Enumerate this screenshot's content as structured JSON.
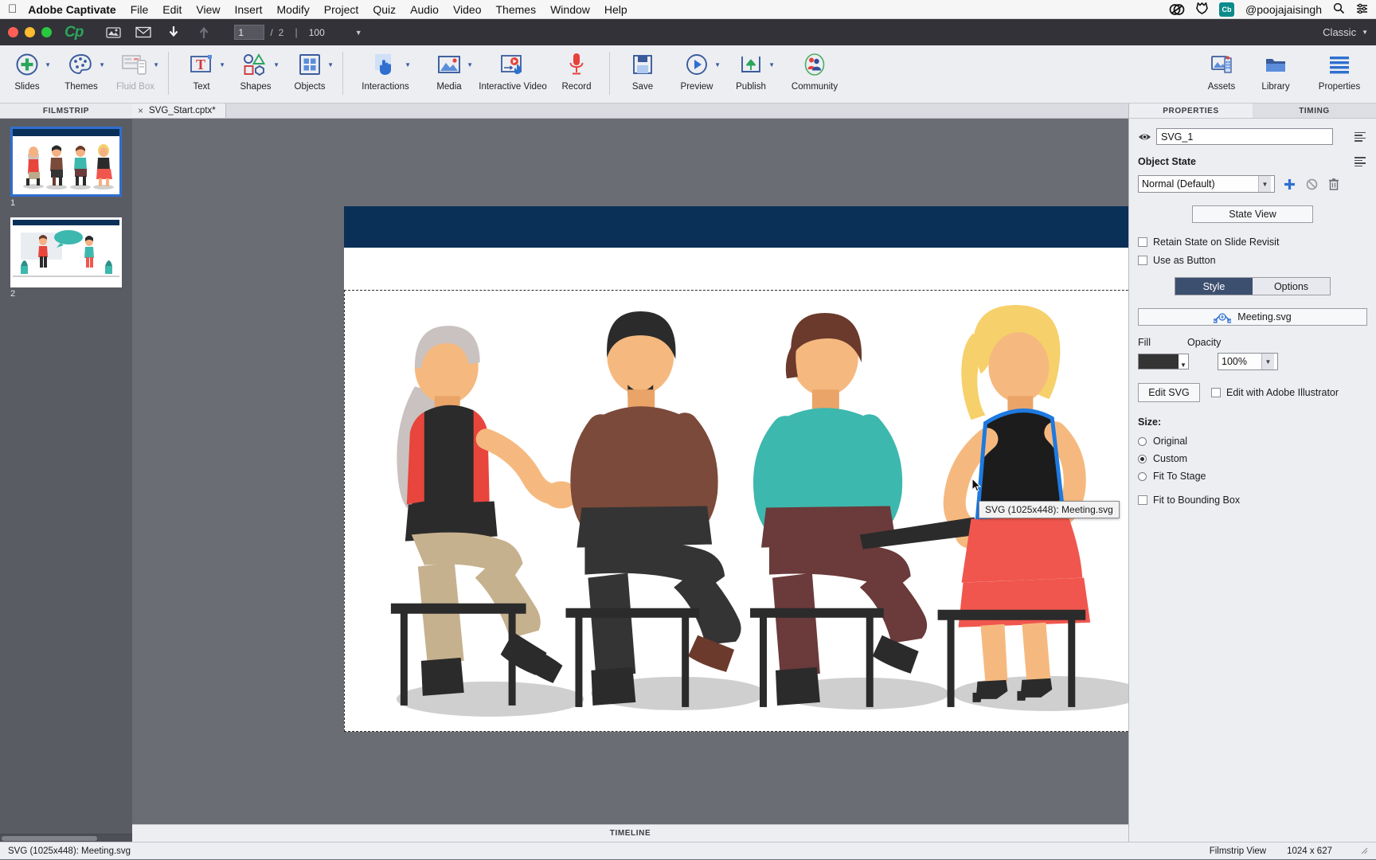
{
  "macmenu": {
    "apple_icon": "apple-icon",
    "app_name": "Adobe Captivate",
    "items": [
      "File",
      "Edit",
      "View",
      "Insert",
      "Modify",
      "Project",
      "Quiz",
      "Audio",
      "Video",
      "Themes",
      "Window",
      "Help"
    ],
    "status_icons": [
      "creative-cloud-icon",
      "sync-icon",
      "cb-badge-icon"
    ],
    "cb_badge_label": "Cb",
    "user": "@poojajaisingh",
    "search_icon": "search-icon",
    "control_center_icon": "control-center-icon"
  },
  "docbar": {
    "traffic": [
      "close-button",
      "minimize-button",
      "zoom-button"
    ],
    "logo": "Cp",
    "icons": [
      "slide-properties-icon",
      "email-icon",
      "download-icon",
      "upload-icon"
    ],
    "slide_current": "1",
    "slide_separator": "/",
    "slide_total": "2",
    "zoom_value": "100",
    "zoom_dropdown_icon": "chevron-down-icon",
    "workspace": "Classic",
    "workspace_caret_icon": "chevron-down-icon"
  },
  "ribbon": {
    "left": [
      {
        "label": "Slides",
        "icon": "add-slide-icon",
        "dropdown": true,
        "disabled": false
      },
      {
        "label": "Themes",
        "icon": "palette-icon",
        "dropdown": true,
        "disabled": false
      },
      {
        "label": "Fluid Box",
        "icon": "fluid-box-icon",
        "dropdown": true,
        "disabled": true
      }
    ],
    "middle": [
      {
        "label": "Text",
        "icon": "text-icon",
        "dropdown": true,
        "disabled": false
      },
      {
        "label": "Shapes",
        "icon": "shapes-icon",
        "dropdown": true,
        "disabled": false
      },
      {
        "label": "Objects",
        "icon": "objects-icon",
        "dropdown": true,
        "disabled": false
      },
      {
        "label": "Interactions",
        "icon": "interactions-icon",
        "dropdown": true,
        "disabled": false
      },
      {
        "label": "Media",
        "icon": "media-icon",
        "dropdown": true,
        "disabled": false
      },
      {
        "label": "Interactive Video",
        "icon": "interactive-video-icon",
        "dropdown": false,
        "disabled": false
      },
      {
        "label": "Record",
        "icon": "microphone-icon",
        "dropdown": false,
        "disabled": false
      }
    ],
    "right_of_divider": [
      {
        "label": "Save",
        "icon": "save-icon",
        "dropdown": false,
        "disabled": false
      },
      {
        "label": "Preview",
        "icon": "preview-play-icon",
        "dropdown": true,
        "disabled": false
      },
      {
        "label": "Publish",
        "icon": "publish-upload-icon",
        "dropdown": true,
        "disabled": false
      },
      {
        "label": "Community",
        "icon": "community-people-icon",
        "dropdown": false,
        "disabled": false
      }
    ],
    "far_right": [
      {
        "label": "Assets",
        "icon": "assets-icon",
        "dropdown": false,
        "disabled": false
      },
      {
        "label": "Library",
        "icon": "library-icon",
        "dropdown": false,
        "disabled": false
      },
      {
        "label": "Properties",
        "icon": "properties-lines-icon",
        "dropdown": false,
        "disabled": false
      }
    ]
  },
  "filmstrip": {
    "title": "FILMSTRIP",
    "slides": [
      {
        "number": "1",
        "selected": true,
        "name": "slide-thumbnail-1"
      },
      {
        "number": "2",
        "selected": false,
        "name": "slide-thumbnail-2"
      }
    ]
  },
  "doctab": {
    "close_icon": "close-icon",
    "title": "SVG_Start.cptx*"
  },
  "canvas": {
    "tooltip": "SVG (1025x448): Meeting.svg",
    "stage_name": "slide-stage"
  },
  "timeline": {
    "title": "TIMELINE"
  },
  "properties": {
    "tab_properties": "PROPERTIES",
    "tab_timing": "TIMING",
    "visibility_icon": "eye-icon",
    "object_name": "SVG_1",
    "object_state_label": "Object State",
    "state_select": "Normal (Default)",
    "state_add_icon": "plus-icon",
    "state_reset_icon": "reset-icon",
    "state_delete_icon": "trash-icon",
    "state_view_button": "State View",
    "retain_state_label": "Retain State on Slide Revisit",
    "retain_state_checked": false,
    "use_as_button_label": "Use as Button",
    "use_as_button_checked": false,
    "tab_style": "Style",
    "tab_options": "Options",
    "style_active": true,
    "svg_file": "Meeting.svg",
    "svg_file_icon": "svg-path-icon",
    "fill_label": "Fill",
    "fill_color": "#343434",
    "opacity_label": "Opacity",
    "opacity_value": "100%",
    "edit_svg_button": "Edit SVG",
    "edit_illustrator_label": "Edit with Adobe Illustrator",
    "edit_illustrator_checked": false,
    "size_label": "Size:",
    "size_options": [
      {
        "label": "Original",
        "selected": false
      },
      {
        "label": "Custom",
        "selected": true
      },
      {
        "label": "Fit To Stage",
        "selected": false
      }
    ],
    "fit_bounding_label": "Fit to Bounding Box",
    "fit_bounding_checked": false
  },
  "statusbar": {
    "left": "SVG (1025x448): Meeting.svg",
    "view_mode": "Filmstrip View",
    "dimensions": "1024 x 627",
    "resize_grip_icon": "resize-grip-icon"
  },
  "colors": {
    "accent_blue": "#2f6fd0",
    "ribbon_bg": "#eceef2",
    "canvas_bg": "#6b6d75",
    "header_band": "#0a3057",
    "selection_blue": "#1e7ae0"
  }
}
